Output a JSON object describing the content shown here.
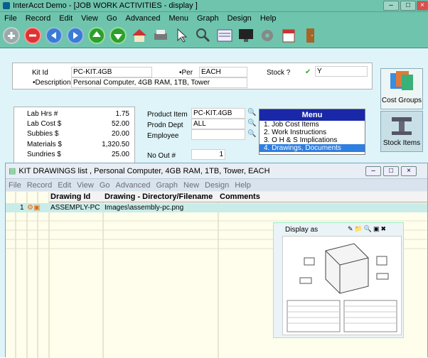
{
  "window": {
    "title": "InterAcct Demo - [JOB WORK ACTIVITIES - display ]"
  },
  "menubar": {
    "items": [
      "File",
      "Record",
      "Edit",
      "View",
      "Go",
      "Advanced",
      "Menu",
      "Graph",
      "Design",
      "Help"
    ]
  },
  "toolbar": {
    "icons": [
      "add-icon",
      "delete-icon",
      "first-icon",
      "last-icon",
      "up-icon",
      "down-icon",
      "home-icon",
      "print-icon",
      "pointer-icon",
      "search-icon",
      "list-icon",
      "monitor-icon",
      "gear-icon",
      "calendar-icon",
      "exit-door-icon"
    ]
  },
  "header": {
    "kit_id_label": "Kit Id",
    "kit_id": "PC-KIT.4GB",
    "per_label": "•Per",
    "per": "EACH",
    "stock_label": "Stock ?",
    "stock": "Y",
    "desc_label": "•Description",
    "desc": "Personal Computer, 4GB RAM, 1TB, Tower"
  },
  "costs": {
    "rows": [
      {
        "label": "Lab Hrs #",
        "value": "1.75"
      },
      {
        "label": "Lab Cost $",
        "value": "52.00"
      },
      {
        "label": "Subbies $",
        "value": "20.00"
      },
      {
        "label": "Materials $",
        "value": "1,320.50"
      },
      {
        "label": "Sundries $",
        "value": "25.00"
      }
    ]
  },
  "product": {
    "item_label": "Product Item",
    "item": "PC-KIT.4GB",
    "dept_label": "Prodn Dept",
    "dept": "ALL",
    "employee_label": "Employee",
    "employee": "",
    "noout_label": "No Out #",
    "noout": "1"
  },
  "menu": {
    "header": "Menu",
    "items": [
      "1. Job Cost Items",
      "2. Work Instructions",
      "3. O H & S Implications",
      "4. Drawings, Documents"
    ]
  },
  "sidebar": {
    "cost_groups": "Cost Groups",
    "stock_items": "Stock Items"
  },
  "subwindow": {
    "title": "KIT DRAWINGS list , Personal Computer, 4GB RAM, 1TB, Tower, EACH",
    "menu": [
      "File",
      "Record",
      "Edit",
      "View",
      "Go",
      "Advanced",
      "Graph",
      "New",
      "Design",
      "Help"
    ]
  },
  "grid": {
    "columns": [
      "Drawing Id",
      "Drawing - Directory/Filename",
      "Comments"
    ],
    "rows": [
      {
        "num": "1",
        "drawing_id": "ASSEMPLY-PC",
        "filename": "Images\\assembly-pc.png",
        "comments": ""
      }
    ]
  },
  "preview": {
    "label": "Display as"
  },
  "colors": {
    "titlebar": "#6fc4ad",
    "menu_header": "#1828a8",
    "selection": "#2f7fe0",
    "background": "#dff4f8"
  }
}
